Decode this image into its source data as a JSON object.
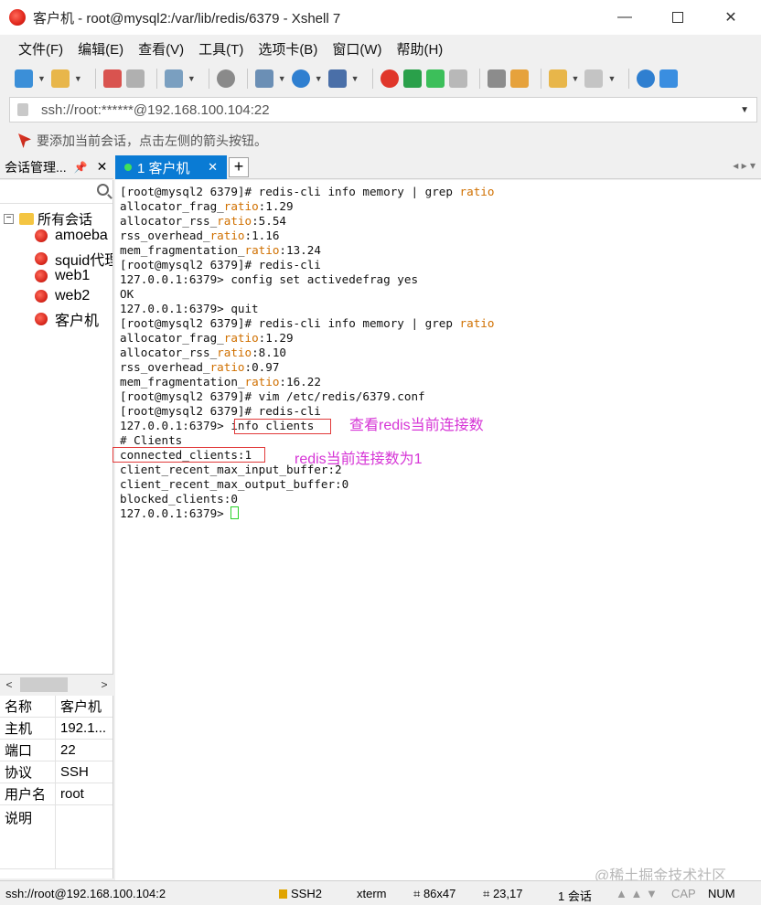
{
  "window": {
    "title": "客户机 - root@mysql2:/var/lib/redis/6379 - Xshell 7",
    "minimize": "—",
    "close": "✕"
  },
  "menu": [
    "文件(F)",
    "编辑(E)",
    "查看(V)",
    "工具(T)",
    "选项卡(B)",
    "窗口(W)",
    "帮助(H)"
  ],
  "address": {
    "value": "ssh://root:******@192.168.100.104:22"
  },
  "hint": "要添加当前会话，点击左侧的箭头按钮。",
  "session_panel": {
    "title": "会话管理...",
    "pin": "ᴾ",
    "close": "✕",
    "root": "所有会话",
    "root_toggle": "−",
    "items": [
      "amoeba",
      "squid代理",
      "web1",
      "web2",
      "客户机"
    ]
  },
  "tabs": {
    "active_label": "1 客户机",
    "close": "✕",
    "add": "+",
    "nav": "◂ ▸ ▾"
  },
  "scroll": {
    "left": "<",
    "right": ">"
  },
  "properties": [
    {
      "key": "名称",
      "value": "客户机"
    },
    {
      "key": "主机",
      "value": "192.1..."
    },
    {
      "key": "端口",
      "value": "22"
    },
    {
      "key": "协议",
      "value": "SSH"
    },
    {
      "key": "用户名",
      "value": "root"
    },
    {
      "key": "说明",
      "value": ""
    }
  ],
  "terminal": {
    "lines": [
      "[root@mysql2 6379]# redis-cli info memory | grep ratio",
      "allocator_frag_ratio:1.29",
      "allocator_rss_ratio:5.54",
      "rss_overhead_ratio:1.16",
      "mem_fragmentation_ratio:13.24",
      "[root@mysql2 6379]# redis-cli",
      "127.0.0.1:6379> config set activedefrag yes",
      "OK",
      "127.0.0.1:6379> quit",
      "[root@mysql2 6379]# redis-cli info memory | grep ratio",
      "allocator_frag_ratio:1.29",
      "allocator_rss_ratio:8.10",
      "rss_overhead_ratio:0.97",
      "mem_fragmentation_ratio:16.22",
      "[root@mysql2 6379]# vim /etc/redis/6379.conf",
      "[root@mysql2 6379]# redis-cli",
      "127.0.0.1:6379> info clients",
      "# Clients",
      "connected_clients:1",
      "client_recent_max_input_buffer:2",
      "client_recent_max_output_buffer:0",
      "blocked_clients:0",
      "127.0.0.1:6379> "
    ],
    "highlight_word": "ratio",
    "highlight_color": "#d07000",
    "annotation_1": "查看redis当前连接数",
    "annotation_2": "redis当前连接数为1",
    "annotation_color": "#d635d6"
  },
  "watermark": "@稀土掘金技术社区",
  "status": {
    "address": "ssh://root@192.168.100.104:2",
    "protocol": "SSH2",
    "term": "xterm",
    "size": "86x47",
    "cursor": "23,17",
    "sessions": "1 会话",
    "arrows": "▲ ▲ ▼",
    "cap": "CAP",
    "num": "NUM"
  },
  "colors": {
    "accent_tab": "#0a7bd4",
    "annotation_box": "#e13a3a"
  }
}
